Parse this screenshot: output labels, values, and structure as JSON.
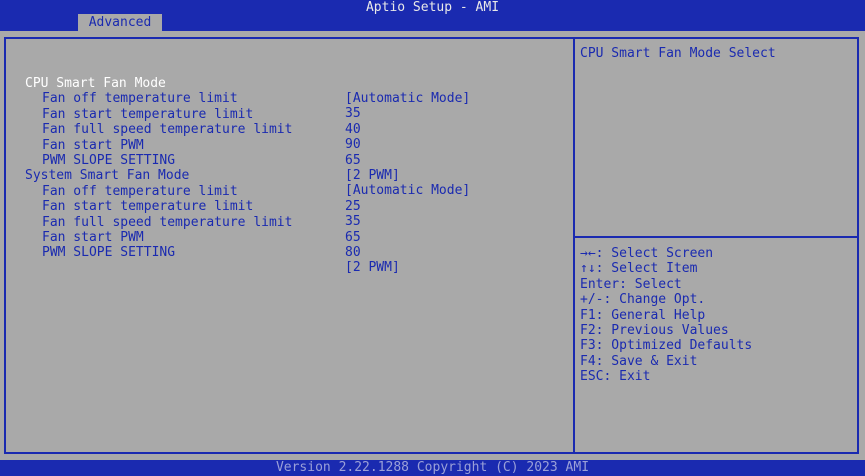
{
  "header": {
    "title": "Aptio Setup - AMI",
    "tab": "Advanced"
  },
  "settings": [
    {
      "label": "CPU Smart Fan Mode",
      "value": "[Automatic Mode]"
    },
    {
      "label": "Fan off temperature limit",
      "value": "35"
    },
    {
      "label": "Fan start temperature limit",
      "value": "40"
    },
    {
      "label": "Fan full speed temperature limit",
      "value": "90"
    },
    {
      "label": "Fan start PWM",
      "value": "65"
    },
    {
      "label": "PWM SLOPE SETTING",
      "value": "[2 PWM]"
    },
    {
      "label": "System Smart Fan Mode",
      "value": "[Automatic Mode]"
    },
    {
      "label": "Fan off temperature limit",
      "value": "25"
    },
    {
      "label": "Fan start temperature limit",
      "value": "35"
    },
    {
      "label": "Fan full speed temperature limit",
      "value": "65"
    },
    {
      "label": "Fan start PWM",
      "value": "80"
    },
    {
      "label": "PWM SLOPE SETTING",
      "value": "[2 PWM]"
    }
  ],
  "help": {
    "description": "CPU Smart Fan Mode Select",
    "keys": [
      "→←: Select Screen",
      "↑↓: Select Item",
      "Enter: Select",
      "+/-: Change Opt.",
      "F1: General Help",
      "F2: Previous Values",
      "F3: Optimized Defaults",
      "F4: Save & Exit",
      "ESC: Exit"
    ]
  },
  "footer": {
    "version": "Version 2.22.1288 Copyright (C) 2023 AMI"
  },
  "colors": {
    "background": "#1a2ab0",
    "panel": "#a9a9a9",
    "text": "#1a2ab0",
    "selected_text": "#ffffff"
  }
}
